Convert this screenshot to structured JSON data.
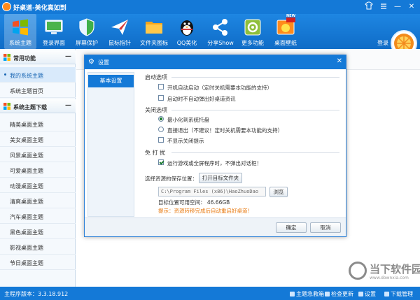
{
  "app": {
    "title": "好桌道-美化真如到"
  },
  "window": {
    "min": "—",
    "max": "□",
    "close": "✕"
  },
  "toolbar": {
    "items": [
      {
        "label": "系统主题",
        "icon": "windows-logo-icon"
      },
      {
        "label": "登录界面",
        "icon": "monitor-icon"
      },
      {
        "label": "屏幕保护",
        "icon": "shield-icon"
      },
      {
        "label": "鼠标指针",
        "icon": "paper-plane-icon"
      },
      {
        "label": "文件夹图标",
        "icon": "folder-icon"
      },
      {
        "label": "QQ美化",
        "icon": "penguin-icon"
      },
      {
        "label": "分享Show",
        "icon": "share-icon"
      },
      {
        "label": "更多功能",
        "icon": "gear-box-icon"
      },
      {
        "label": "桌面壁纸",
        "icon": "new-wallpaper-icon"
      }
    ],
    "new_badge": "NEW",
    "login": "登录"
  },
  "sidebar": {
    "section1": {
      "title": "常用功能",
      "toggle": "—"
    },
    "common_items": [
      "我的系统主题",
      "系统主题首页"
    ],
    "section2": {
      "title": "系统主题下载",
      "toggle": "—"
    },
    "download_items": [
      "精美桌面主题",
      "美女桌面主题",
      "风景桌面主题",
      "可爱桌面主题",
      "动漫桌面主题",
      "清爽桌面主题",
      "汽车桌面主题",
      "黑色桌面主题",
      "影视桌面主题",
      "节日桌面主题"
    ]
  },
  "dialog": {
    "title": "设置",
    "close": "✕",
    "tab": "基本设置",
    "startup": {
      "title": "启动选项",
      "opt1": "开机自动启动（定时关机需要本功能的支持）",
      "opt2": "启动时不自动弹出好桌道资讯"
    },
    "close_opts": {
      "title": "关闭选项",
      "opt1": "最小化到系统托盘",
      "opt2": "直接退出（不建议！定时关机需要本功能的支持）",
      "opt3": "不显示关闭提示"
    },
    "dnd": {
      "title": "免 打 扰",
      "opt1": "运行游戏或全屏程序时，不弹出对话框！"
    },
    "save": {
      "label": "选择资源的保存位置：",
      "open_btn": "打开目标文件夹",
      "path": "C:\\Program Files (x86)\\HaoZhuoDao",
      "browse_btn": "浏览",
      "free_space": "目标位置可用空间：  46.66GB",
      "hint": "提示：资源转移完成后自动重启好桌道！"
    },
    "ok": "确定",
    "cancel": "取消"
  },
  "status": {
    "version": "主程序版本：3.3.18.912",
    "items": [
      "主题急救箱",
      "检查更新",
      "设置",
      "下载管理"
    ]
  },
  "watermark": {
    "text": "当下软件园",
    "url": "www.downxia.com"
  },
  "colors": {
    "brand": "#1479d7",
    "accent_orange": "#e8790f",
    "hint_red": "#e8790f"
  }
}
